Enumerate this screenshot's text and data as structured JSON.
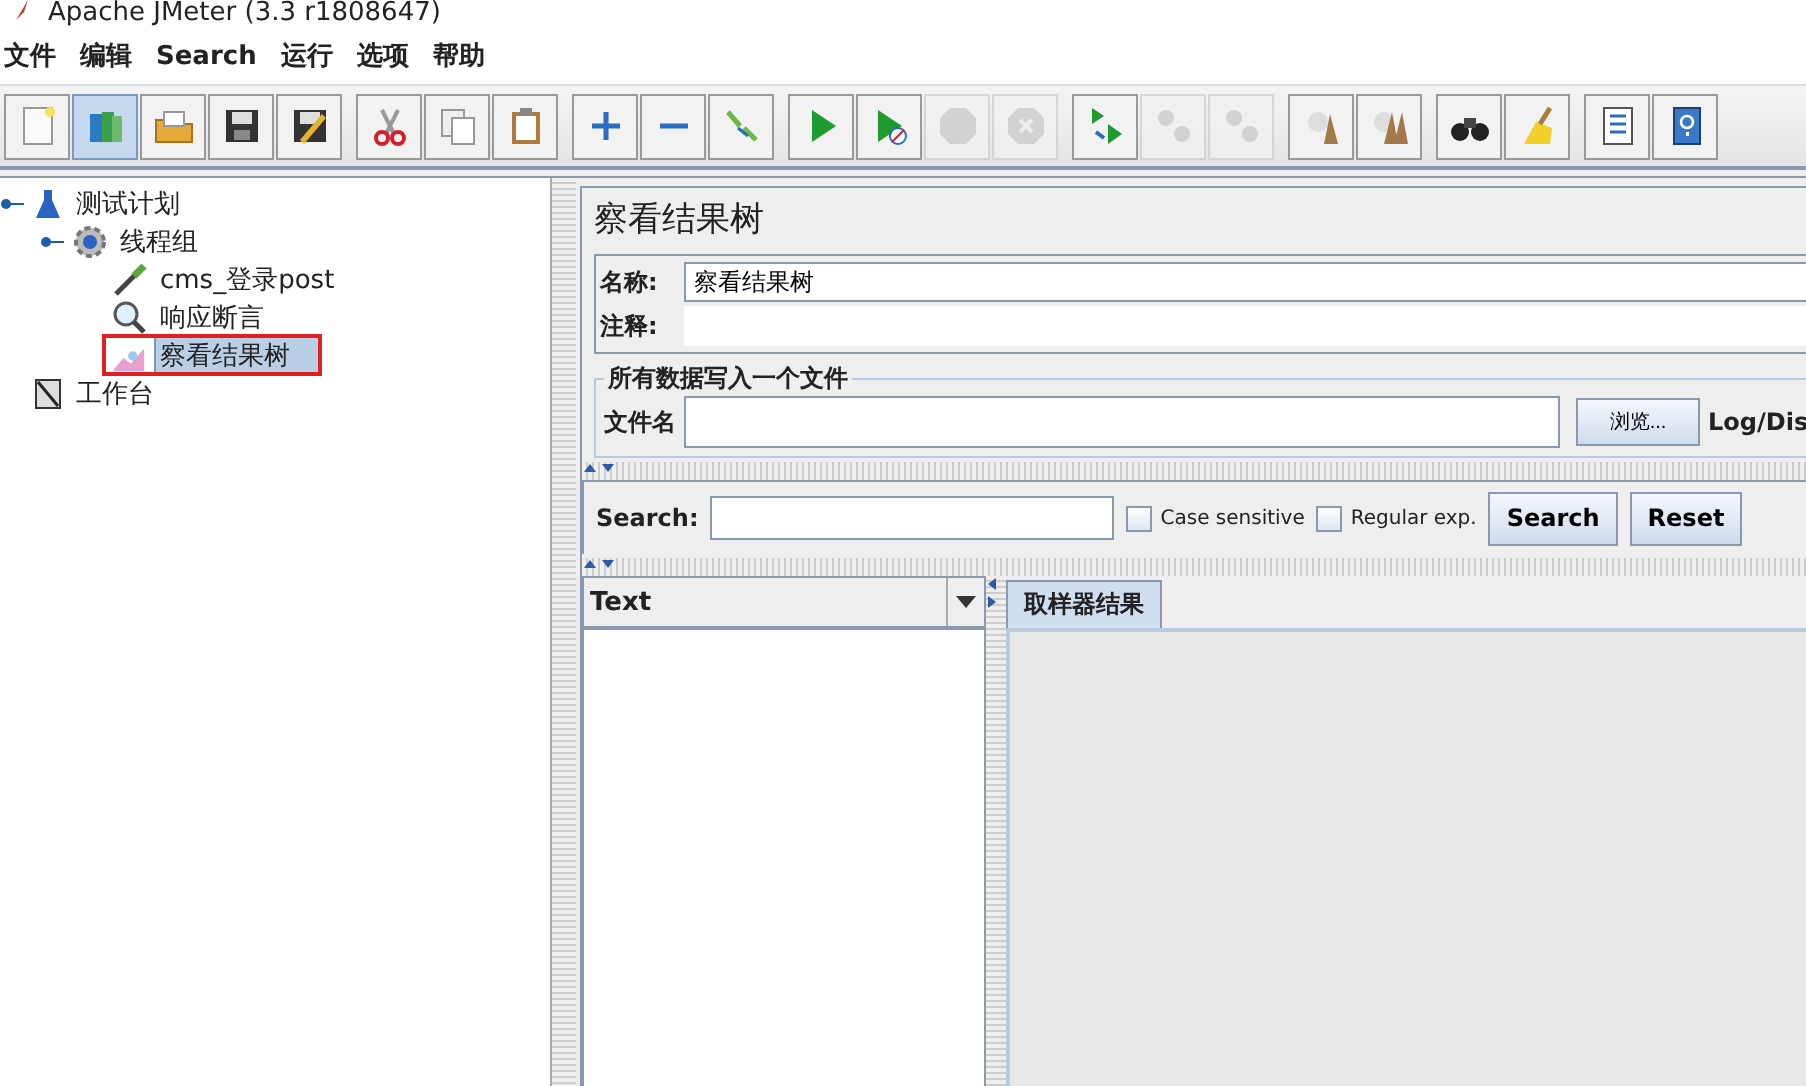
{
  "window": {
    "title": "Apache JMeter (3.3 r1808647)"
  },
  "menu": [
    "文件",
    "编辑",
    "Search",
    "运行",
    "选项",
    "帮助"
  ],
  "toolbar": [
    [
      {
        "kind": "new",
        "disabled": false
      },
      {
        "kind": "templates",
        "disabled": false,
        "selected": true
      },
      {
        "kind": "open",
        "disabled": false
      },
      {
        "kind": "save",
        "disabled": false
      },
      {
        "kind": "save-as",
        "disabled": false
      }
    ],
    [
      {
        "kind": "cut",
        "disabled": false
      },
      {
        "kind": "copy",
        "disabled": false
      },
      {
        "kind": "paste",
        "disabled": false
      }
    ],
    [
      {
        "kind": "expand",
        "disabled": false
      },
      {
        "kind": "collapse",
        "disabled": false
      },
      {
        "kind": "toggle",
        "disabled": false
      }
    ],
    [
      {
        "kind": "start",
        "disabled": false
      },
      {
        "kind": "start-no-timers",
        "disabled": false
      },
      {
        "kind": "stop",
        "disabled": true
      },
      {
        "kind": "shutdown",
        "disabled": true
      }
    ],
    [
      {
        "kind": "remote-start",
        "disabled": false
      },
      {
        "kind": "remote-stop",
        "disabled": true
      },
      {
        "kind": "remote-shutdown",
        "disabled": true
      }
    ],
    [
      {
        "kind": "clear",
        "disabled": false
      },
      {
        "kind": "clear-all",
        "disabled": false
      }
    ],
    [
      {
        "kind": "search",
        "disabled": false
      },
      {
        "kind": "reset",
        "disabled": false
      }
    ],
    [
      {
        "kind": "functions",
        "disabled": false
      },
      {
        "kind": "help",
        "disabled": false
      }
    ]
  ],
  "tree": [
    {
      "label": "测试计划",
      "kind": "plan",
      "selected": false,
      "annotated": false,
      "children": [
        {
          "label": "线程组",
          "kind": "threads",
          "selected": false,
          "annotated": false,
          "children": [
            {
              "label": "cms_登录post",
              "kind": "sampler",
              "selected": false,
              "annotated": false
            },
            {
              "label": "响应断言",
              "kind": "assertion",
              "selected": false,
              "annotated": false
            },
            {
              "label": "察看结果树",
              "kind": "listener",
              "selected": true,
              "annotated": true
            }
          ]
        }
      ]
    },
    {
      "label": "工作台",
      "kind": "workbench",
      "selected": false,
      "annotated": false
    }
  ],
  "panel": {
    "title": "察看结果树",
    "name_label": "名称:",
    "name_value": "察看结果树",
    "comment_label": "注释:",
    "file_group": {
      "title": "所有数据写入一个文件",
      "filename_label": "文件名",
      "browse_button": "浏览...",
      "log_label": "Log/Dis"
    },
    "search": {
      "label": "Search:",
      "options": [
        {
          "label": "Case sensitive",
          "checked": false
        },
        {
          "label": "Regular exp.",
          "checked": false
        }
      ],
      "buttons": [
        "Search",
        "Reset"
      ]
    },
    "renderer": "Text",
    "tabs": [
      {
        "label": "取样器结果",
        "selected": true
      }
    ]
  }
}
